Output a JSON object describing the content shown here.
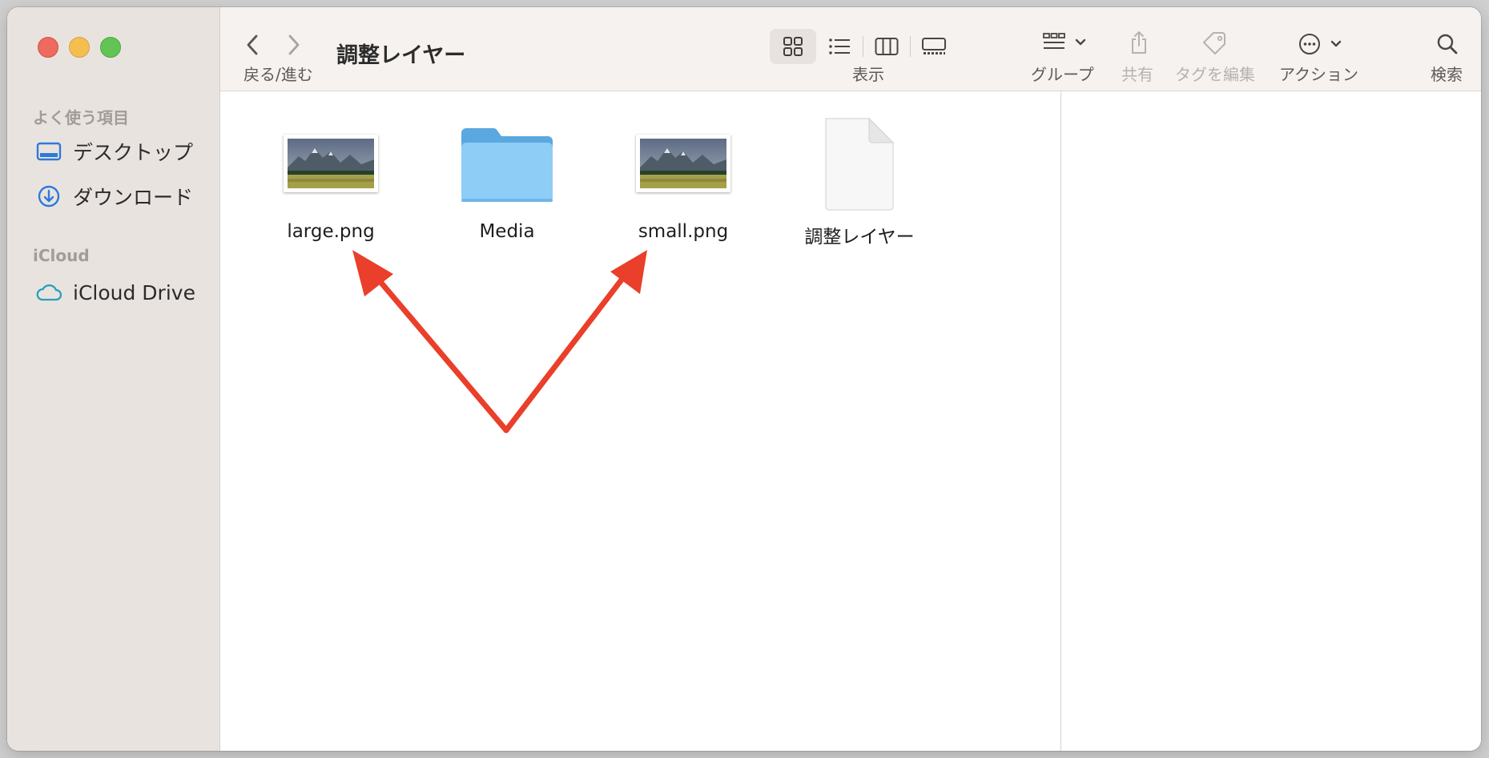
{
  "window": {
    "title": "調整レイヤー"
  },
  "sidebar": {
    "favorites_heading": "よく使う項目",
    "favorites": [
      {
        "label": "デスクトップ",
        "icon": "desktop-icon"
      },
      {
        "label": "ダウンロード",
        "icon": "download-icon"
      }
    ],
    "icloud_heading": "iCloud",
    "icloud": [
      {
        "label": "iCloud Drive",
        "icon": "cloud-icon"
      }
    ]
  },
  "toolbar": {
    "nav_label": "戻る/進む",
    "view_label": "表示",
    "group_label": "グループ",
    "share_label": "共有",
    "tags_label": "タグを編集",
    "action_label": "アクション",
    "search_label": "検索"
  },
  "files": [
    {
      "name": "large.png",
      "kind": "image"
    },
    {
      "name": "Media",
      "kind": "folder"
    },
    {
      "name": "small.png",
      "kind": "image"
    },
    {
      "name": "調整レイヤー",
      "kind": "document"
    }
  ],
  "colors": {
    "sidebar_bg": "#e9e3e0",
    "toolbar_bg": "#f6f2ef",
    "accent_blue": "#2f7ad8",
    "annotation_red": "#ea3f2a",
    "folder_blue": "#8dcdf6"
  }
}
